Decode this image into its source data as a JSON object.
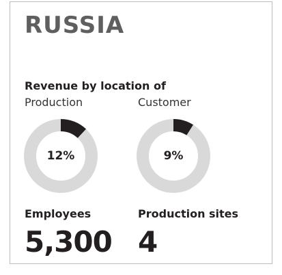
{
  "country": "RUSSIA",
  "revenue": {
    "title": "Revenue by location of",
    "production": {
      "label": "Production",
      "value_text": "12%",
      "fraction": 0.12
    },
    "customer": {
      "label": "Customer",
      "value_text": "9%",
      "fraction": 0.09
    }
  },
  "stats": {
    "employees": {
      "label": "Employees",
      "value": "5,300"
    },
    "sites": {
      "label": "Production sites",
      "value": "4"
    }
  },
  "colors": {
    "ring_bg": "#d9d9d9",
    "ring_fg": "#231f20",
    "title": "#5f5f5f"
  }
}
